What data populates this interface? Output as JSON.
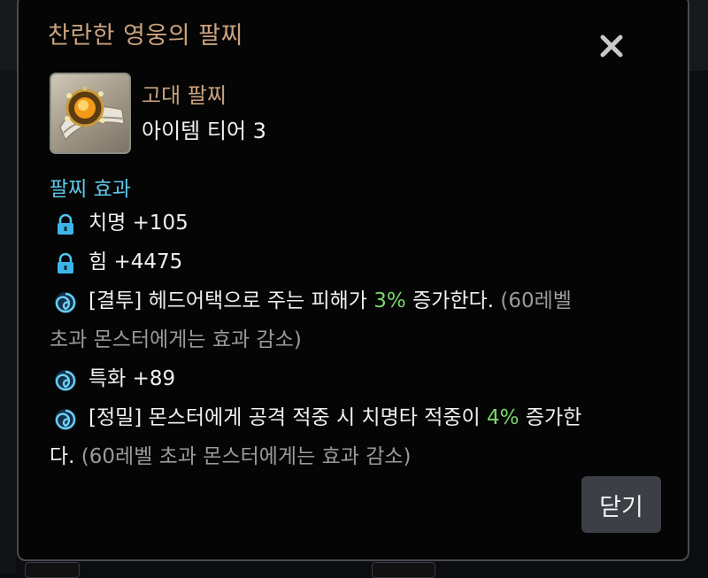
{
  "tooltip": {
    "title": "찬란한 영웅의 팔찌",
    "item_type": "고대 팔찌",
    "item_tier": "아이템 티어 3",
    "section_title": "팔찌 효과",
    "close_button": "닫기"
  },
  "effects": [
    {
      "icon": "lock-icon",
      "text": "치명 +105"
    },
    {
      "icon": "lock-icon",
      "text": "힘 +4475"
    },
    {
      "icon": "swirl-icon",
      "prefix": "[결투] 헤드어택으로 주는 피해가 ",
      "highlight": "3%",
      "suffix": " 증가한다.",
      "note_line1": " (60레벨",
      "note_line2": "초과 몬스터에게는 효과 감소)"
    },
    {
      "icon": "swirl-icon",
      "text": "특화 +89"
    },
    {
      "icon": "swirl-icon",
      "prefix": "[정밀] 몬스터에게 공격 적중 시 치명타 적중이 ",
      "highlight": "4%",
      "suffix": " 증가한",
      "line2_text": "다.",
      "note": " (60레벨 초과 몬스터에게는 효과 감소)"
    }
  ],
  "colors": {
    "title": "#c9a27e",
    "section": "#5fc6e6",
    "highlight": "#79d66b",
    "note": "#9a9a9a"
  }
}
